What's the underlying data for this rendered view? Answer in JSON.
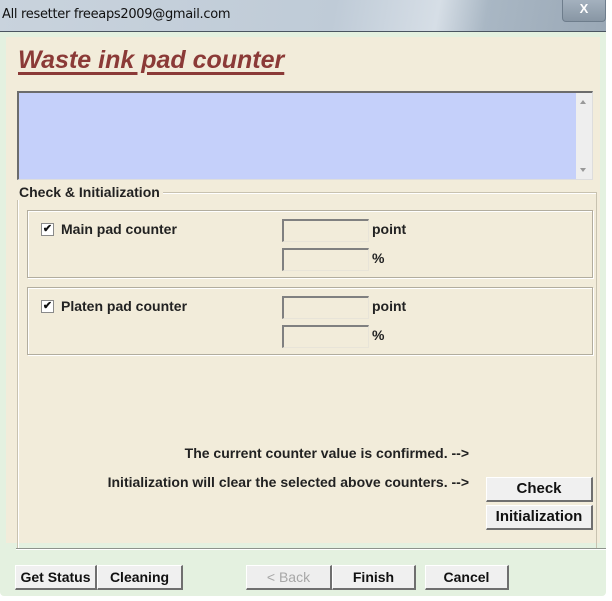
{
  "window": {
    "title": "All resetter freeaps2009@gmail.com",
    "close_label": "X"
  },
  "page": {
    "title": "Waste ink pad counter"
  },
  "log": {
    "text": ""
  },
  "check_group": {
    "label": "Check & Initialization",
    "counters": [
      {
        "label": "Main pad counter",
        "checked": true,
        "point_value": "",
        "point_unit": "point",
        "percent_value": "",
        "percent_unit": "%"
      },
      {
        "label": "Platen pad counter",
        "checked": true,
        "point_value": "",
        "point_unit": "point",
        "percent_value": "",
        "percent_unit": "%"
      }
    ],
    "check_hint": "The current counter value is confirmed. -->",
    "check_button": "Check",
    "init_hint": "Initialization will clear the selected above counters. -->",
    "init_button": "Initialization"
  },
  "footer": {
    "get_status": "Get Status",
    "cleaning": "Cleaning",
    "back": "< Back",
    "finish": "Finish",
    "cancel": "Cancel"
  },
  "colors": {
    "title_accent": "#8b3a37",
    "log_background": "#c5d0fa",
    "panel_background": "#f2ecda",
    "frame_background": "#e4f1e0"
  },
  "checkmark_glyph": "✔"
}
